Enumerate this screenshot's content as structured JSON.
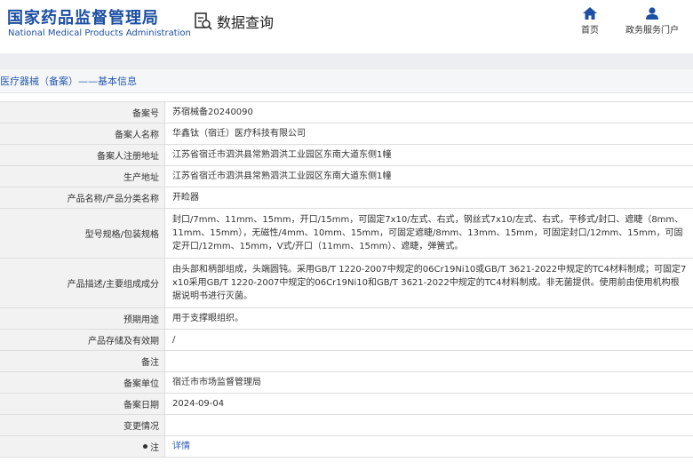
{
  "header": {
    "logo_cn": "国家药品监督管理局",
    "logo_en": "National Medical Products Administration",
    "section_title": "数据查询",
    "nav": [
      {
        "label": "首页",
        "icon": "home-icon"
      },
      {
        "label": "政务服务门户",
        "icon": "user-icon"
      }
    ]
  },
  "breadcrumb": "医疗器械（备案）——基本信息",
  "colors": {
    "brand": "#1d4fa3",
    "link": "#2a5bb0",
    "label_bg": "#f2f2f2"
  },
  "fields": [
    {
      "label": "备案号",
      "value": "苏宿械备20240090"
    },
    {
      "label": "备案人名称",
      "value": "华鑫钛（宿迁）医疗科技有限公司"
    },
    {
      "label": "备案人注册地址",
      "value": "江苏省宿迁市泗洪县常熟泗洪工业园区东南大道东侧1幢"
    },
    {
      "label": "生产地址",
      "value": "江苏省宿迁市泗洪县常熟泗洪工业园区东南大道东侧1幢"
    },
    {
      "label": "产品名称/产品分类名称",
      "value": "开睑器"
    },
    {
      "label": "型号规格/包装规格",
      "value": "封口/7mm、11mm、15mm，开口/15mm，可固定7x10/左式、右式，钢丝式7x10/左式、右式，平移式/封口、遮睫（8mm、11mm、15mm），无磁性/4mm、10mm、15mm，可固定遮睫/8mm、13mm、15mm，可固定封口/12mm、15mm，可固定开口/12mm、15mm，V式/开口（11mm、15mm）、遮睫，弹簧式。"
    },
    {
      "label": "产品描述/主要组成成分",
      "value": "由头部和柄部组成，头端圆钝。采用GB/T 1220-2007中规定的06Cr19Ni10或GB/T 3621-2022中规定的TC4材料制成；可固定7x10采用GB/T 1220-2007中规定的06Cr19Ni10和GB/T 3621-2022中规定的TC4材料制成。非无菌提供。使用前由使用机构根据说明书进行灭菌。"
    },
    {
      "label": "预期用途",
      "value": "用于支撑眼组织。"
    },
    {
      "label": "产品存储及有效期",
      "value": "/"
    },
    {
      "label": "备注",
      "value": ""
    },
    {
      "label": "备案单位",
      "value": "宿迁市市场监督管理局"
    },
    {
      "label": "备案日期",
      "value": "2024-09-04"
    },
    {
      "label": "变更情况",
      "value": ""
    },
    {
      "label": "注",
      "value": "详情"
    }
  ]
}
